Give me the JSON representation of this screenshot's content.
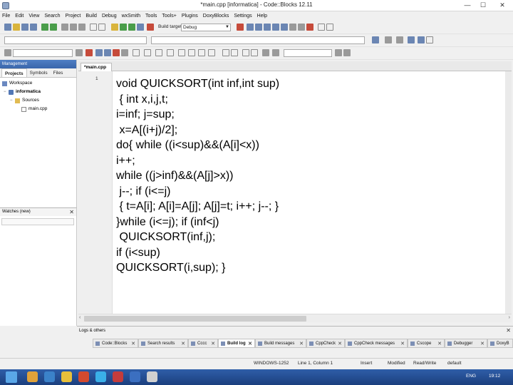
{
  "window": {
    "title": "*main.cpp [informatica] - Code::Blocks 12.11",
    "min": "—",
    "max": "☐",
    "close": "✕"
  },
  "menu": [
    "File",
    "Edit",
    "View",
    "Search",
    "Project",
    "Build",
    "Debug",
    "wxSmith",
    "Tools",
    "Tools+",
    "Plugins",
    "DoxyBlocks",
    "Settings",
    "Help"
  ],
  "toolbar": {
    "build_target_label": "Build target:",
    "build_target_value": "Debug"
  },
  "management": {
    "title": "Management",
    "tabs": [
      "Projects",
      "Symbols",
      "Files"
    ],
    "tree": {
      "workspace": "Workspace",
      "project": "informatica",
      "folder": "Sources",
      "file": "main.cpp"
    }
  },
  "watches": {
    "title": "Watches (new)"
  },
  "editor": {
    "tab": "*main.cpp",
    "line_number": "1",
    "code": [
      "void QUICKSORT(int inf,int sup)",
      " { int x,i,j,t;",
      "i=inf; j=sup;",
      " x=A[(i+j)/2];",
      "do{ while ((i<sup)&&(A[i]<x))",
      "i++;",
      "while ((j>inf)&&(A[j]>x))",
      " j--; if (i<=j)",
      " { t=A[i]; A[i]=A[j]; A[j]=t; i++; j--; }",
      "}while (i<=j); if (inf<j)",
      " QUICKSORT(inf,j);",
      "if (i<sup)",
      "QUICKSORT(i,sup); }"
    ]
  },
  "logs": {
    "title": "Logs & others",
    "tabs": [
      "Code::Blocks",
      "Search results",
      "Cccc",
      "Build log",
      "Build messages",
      "CppCheck",
      "CppCheck messages",
      "Cscope",
      "Debugger",
      "DoxyB"
    ]
  },
  "status": {
    "encoding": "WINDOWS-1252",
    "position": "Line 1, Column 1",
    "mode": "Insert",
    "modified": "Modified",
    "access": "Read/Write",
    "profile": "default"
  },
  "taskbar": {
    "lang": "ENG",
    "time": "19:12"
  },
  "colors": {
    "taskbar": "#1b3f7e",
    "panel_header": "#3a66ab"
  }
}
